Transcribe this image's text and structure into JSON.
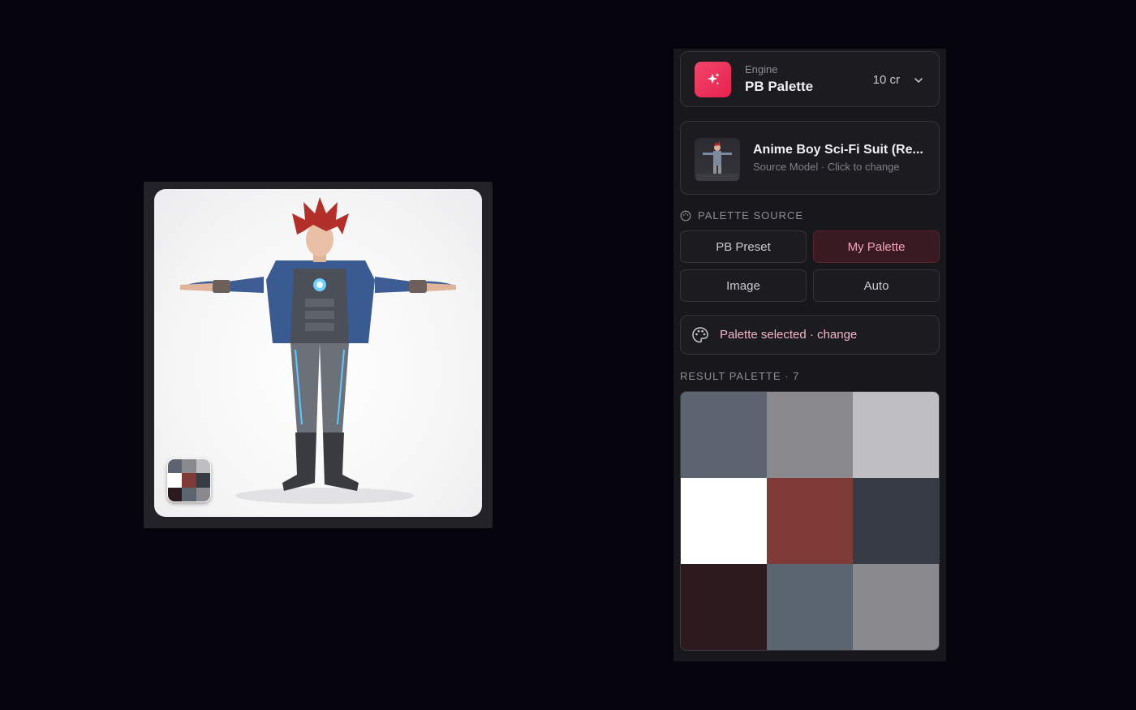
{
  "engine": {
    "caption": "Engine",
    "name": "PB Palette",
    "cost": "10 cr",
    "icon": "sparkles-icon",
    "accent": "#e8214d"
  },
  "source_model": {
    "title": "Anime Boy Sci-Fi Suit (Re...",
    "subtitle": "Source Model · Click to change"
  },
  "palette_source": {
    "label": "PALETTE SOURCE",
    "options": [
      "PB Preset",
      "My Palette",
      "Image",
      "Auto"
    ],
    "selected": "My Palette"
  },
  "palette_status": {
    "text": "Palette selected · change",
    "icon": "palette-icon"
  },
  "result_palette": {
    "label": "RESULT PALETTE · 7",
    "colors": [
      "#5b6470",
      "#8a898e",
      "#bfbfc1",
      "#ffffff",
      "#7d3a37",
      "#363b45",
      "#2c1a1d",
      "#5a6570",
      "#8a898e"
    ]
  },
  "preview": {
    "mini_palette_colors": [
      "#5b6470",
      "#8a898e",
      "#bfbfc1",
      "#ffffff",
      "#7d3a37",
      "#363b45",
      "#2c1a1d",
      "#5a6570",
      "#8a898e"
    ]
  }
}
